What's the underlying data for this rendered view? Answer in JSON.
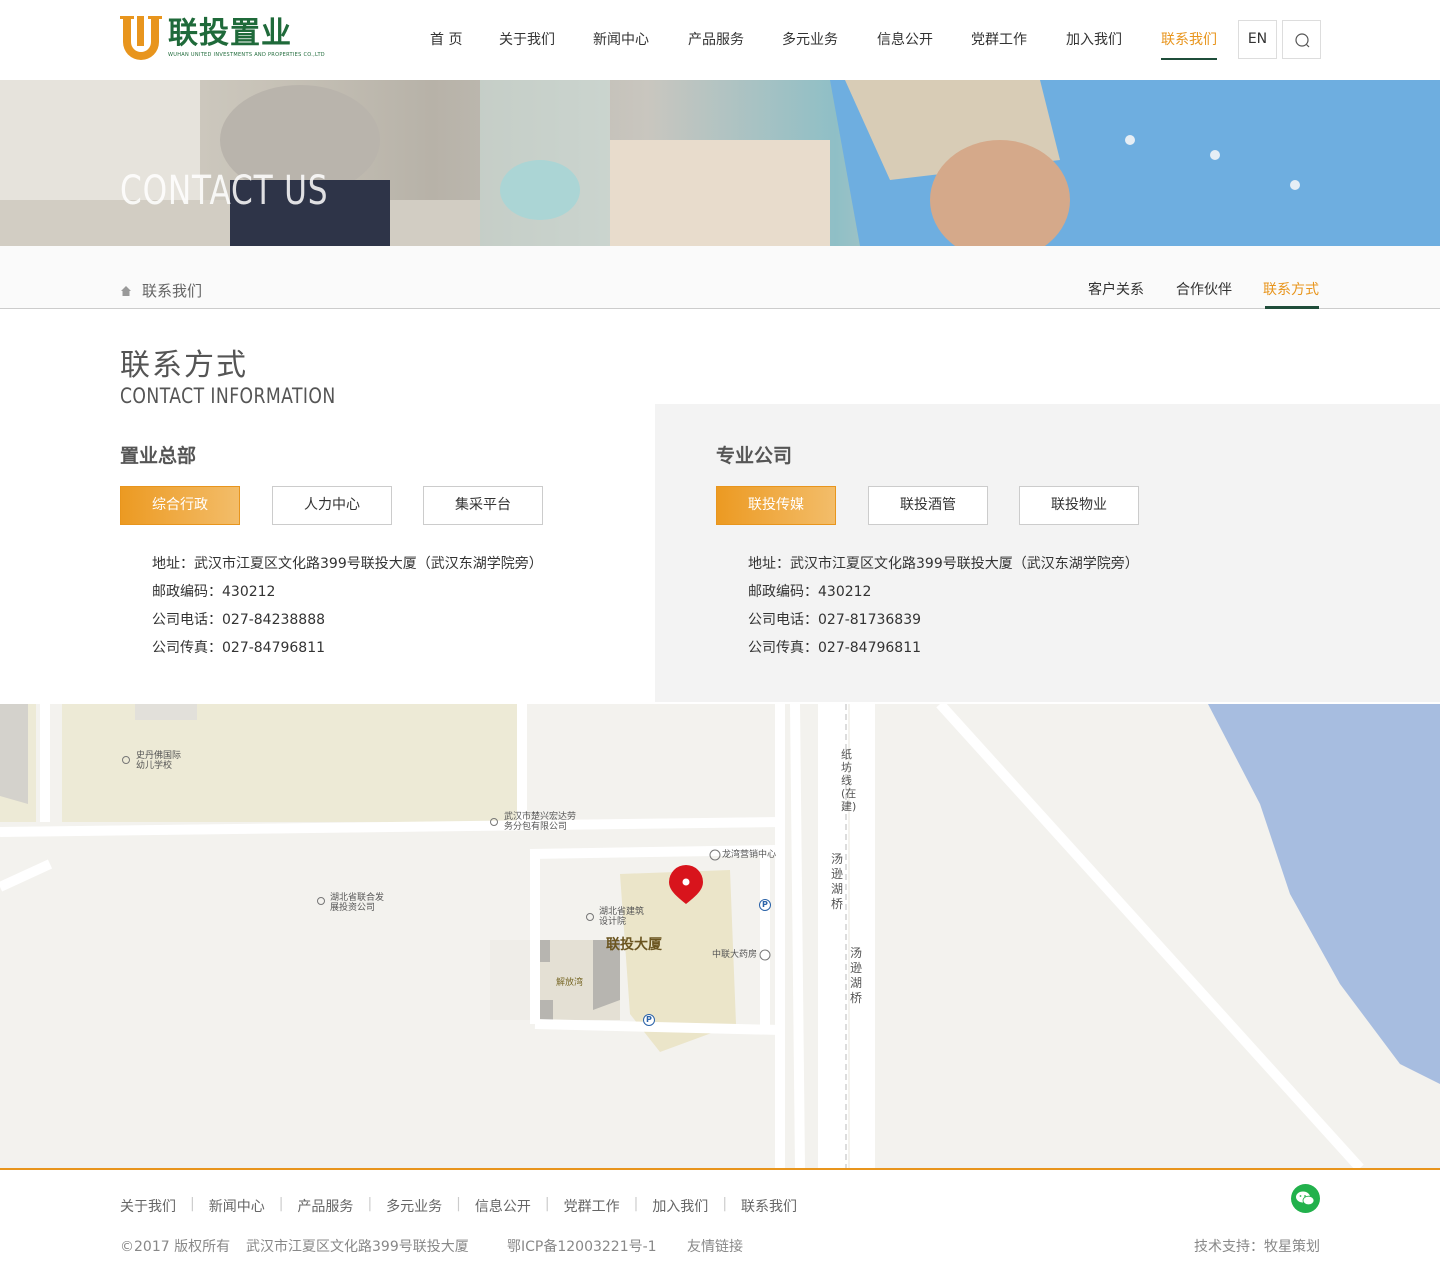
{
  "header": {
    "logo_cn": "联投置业",
    "logo_en": "WUHAN UNITED INVESTMENTS AND PROPERTIES CO.,LTD",
    "nav": [
      "首 页",
      "关于我们",
      "新闻中心",
      "产品服务",
      "多元业务",
      "信息公开",
      "党群工作",
      "加入我们",
      "联系我们"
    ],
    "active_nav": "联系我们",
    "lang": "EN"
  },
  "banner": {
    "title": "CONTACT US"
  },
  "breadcrumb": {
    "current": "联系我们"
  },
  "subnav": [
    "客户关系",
    "合作伙伴",
    "联系方式"
  ],
  "section": {
    "title": "联系方式",
    "subtitle": "CONTACT INFORMATION"
  },
  "left": {
    "title": "置业总部",
    "tabs": [
      "综合行政",
      "人力中心",
      "集采平台"
    ],
    "info": [
      "地址：武汉市江夏区文化路399号联投大厦（武汉东湖学院旁）",
      "邮政编码：430212",
      "公司电话：027-84238888",
      "公司传真：027-84796811"
    ]
  },
  "right": {
    "title": "专业公司",
    "tabs": [
      "联投传媒",
      "联投酒管",
      "联投物业"
    ],
    "info": [
      "地址：武汉市江夏区文化路399号联投大厦（武汉东湖学院旁）",
      "邮政编码：430212",
      "公司电话：027-81736839",
      "公司传真：027-84796811"
    ]
  },
  "map": {
    "labels": {
      "school": "史丹佛国际幼儿学校",
      "company1": "武汉市楚兴宏达劳务分包有限公司",
      "marketing": "龙湾营销中心",
      "company2": "湖北省联合发展投资公司",
      "design": "湖北省建筑设计院",
      "building": "联投大厦",
      "pharmacy": "中联大药房",
      "jiefang": "解放湾",
      "railway": "纸坊线(在建)",
      "bridge1": "汤逊湖桥",
      "bridge2": "汤逊湖桥",
      "parking": "P"
    }
  },
  "footer": {
    "nav": [
      "关于我们",
      "新闻中心",
      "产品服务",
      "多元业务",
      "信息公开",
      "党群工作",
      "加入我们",
      "联系我们"
    ],
    "copyright": "©2017 版权所有",
    "address": "武汉市江夏区文化路399号联投大厦",
    "icp": "鄂ICP备12003221号-1",
    "links": "友情链接",
    "support": "技术支持：牧星策划"
  },
  "colors": {
    "accent": "#e8951d",
    "brand_green": "#1f6a3a",
    "nav_underline": "#1f4d3a"
  }
}
